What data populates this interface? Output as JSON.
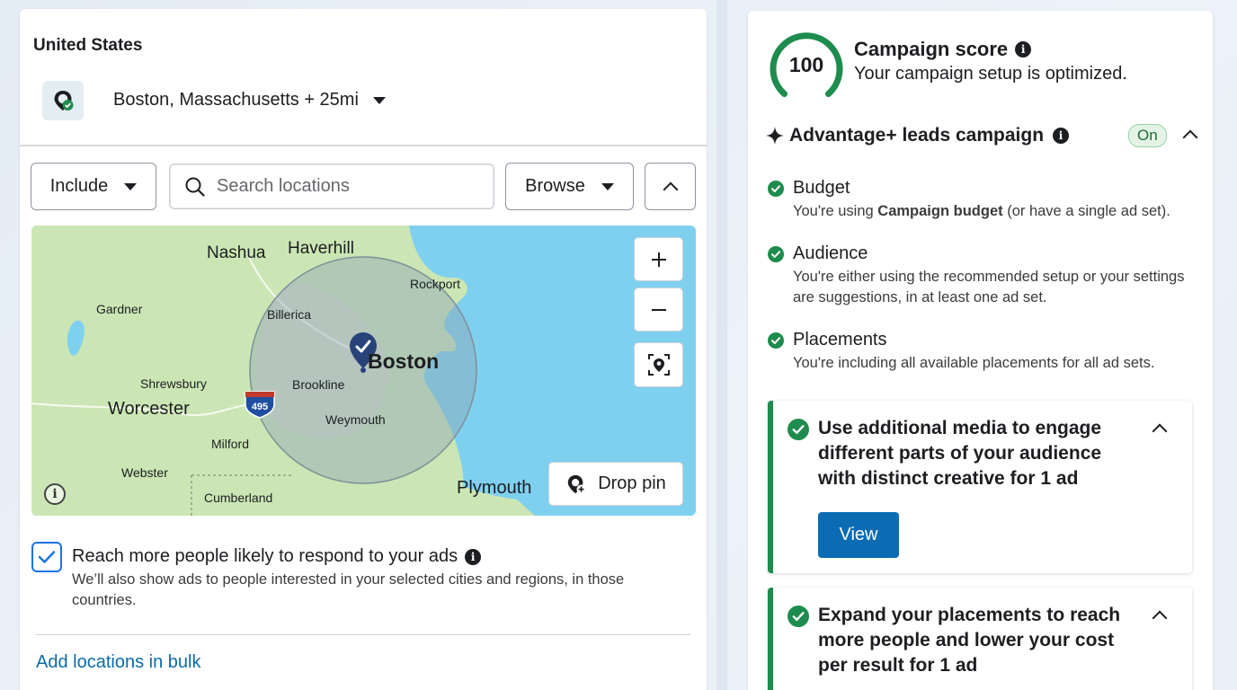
{
  "location": {
    "country": "United States",
    "selected": "Boston, Massachusetts + 25mi"
  },
  "controls": {
    "include_label": "Include",
    "search_placeholder": "Search locations",
    "browse_label": "Browse"
  },
  "map": {
    "places": [
      {
        "id": "nashua",
        "label": "Nashua"
      },
      {
        "id": "haverhill",
        "label": "Haverhill"
      },
      {
        "id": "rockport",
        "label": "Rockport"
      },
      {
        "id": "gardner",
        "label": "Gardner"
      },
      {
        "id": "billerica",
        "label": "Billerica"
      },
      {
        "id": "boston",
        "label": "Boston"
      },
      {
        "id": "shrewsbury",
        "label": "Shrewsbury"
      },
      {
        "id": "brookline",
        "label": "Brookline"
      },
      {
        "id": "worcester",
        "label": "Worcester"
      },
      {
        "id": "weymouth",
        "label": "Weymouth"
      },
      {
        "id": "milford",
        "label": "Milford"
      },
      {
        "id": "webster",
        "label": "Webster"
      },
      {
        "id": "cumberland",
        "label": "Cumberland"
      },
      {
        "id": "plymouth",
        "label": "Plymouth"
      }
    ],
    "highway_shield": "495",
    "drop_pin_label": "Drop pin",
    "colors": {
      "land": "#cbe6b4",
      "water": "#7fd0ef",
      "radius": "#9fb7c6"
    }
  },
  "reach": {
    "checked": true,
    "title": "Reach more people likely to respond to your ads",
    "description": "We’ll also show ads to people interested in your selected cities and regions, in those countries."
  },
  "bulk_link": "Add locations in bulk",
  "score": {
    "value": "100",
    "title": "Campaign score",
    "subtitle": "Your campaign setup is optimized.",
    "color": "#1e8c4e"
  },
  "advantage": {
    "title": "Advantage+ leads campaign",
    "status": "On"
  },
  "checks": [
    {
      "title": "Budget",
      "desc_before": "You're using ",
      "desc_bold": "Campaign budget",
      "desc_after": " (or have a single ad set)."
    },
    {
      "title": "Audience",
      "desc": "You're either using the recommended setup or your settings are suggestions, in at least one ad set."
    },
    {
      "title": "Placements",
      "desc": "You're including all available placements for all ad sets."
    }
  ],
  "recommendations": [
    {
      "title": "Use additional media to engage different parts of your audience with distinct creative for 1 ad",
      "button": "View"
    },
    {
      "title": "Expand your placements to reach more people and lower your cost per result for 1 ad"
    }
  ]
}
